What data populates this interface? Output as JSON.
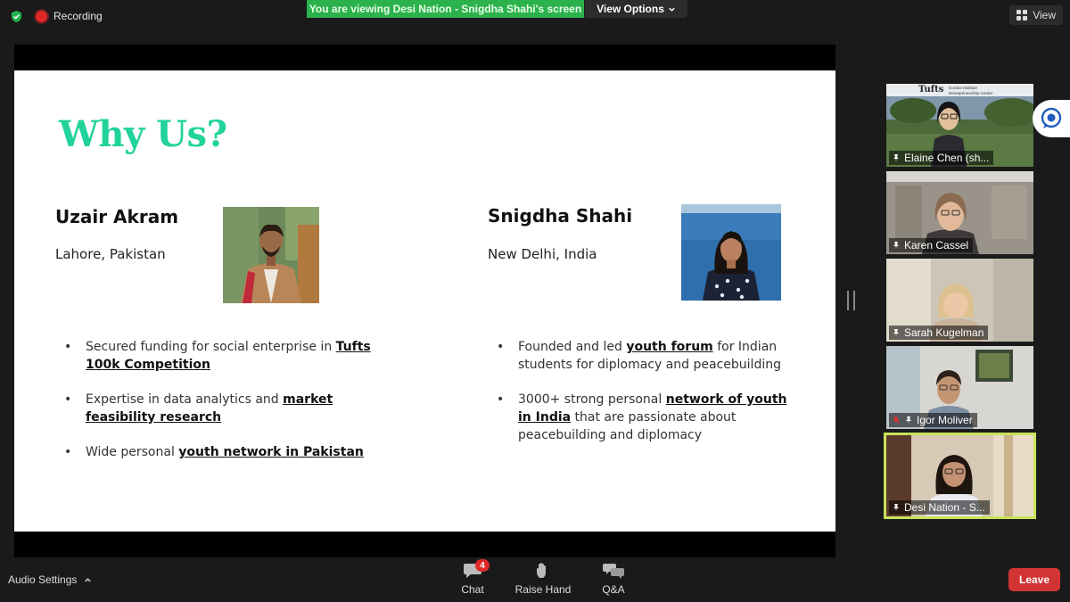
{
  "top_bar": {
    "recording_label": "Recording",
    "viewing_banner": "You are viewing Desi Nation - Snigdha Shahi's screen",
    "view_options_label": "View Options",
    "view_label": "View"
  },
  "slide": {
    "title": "Why Us?",
    "left": {
      "name": "Uzair Akram",
      "location": "Lahore, Pakistan",
      "bullets": [
        {
          "pre": "Secured funding for social enterprise in ",
          "link": "Tufts 100k Competition",
          "post": ""
        },
        {
          "pre": "Expertise in data analytics and ",
          "link": "market feasibility research",
          "post": ""
        },
        {
          "pre": "Wide personal ",
          "link": "youth network in Pakistan",
          "post": ""
        }
      ]
    },
    "right": {
      "name": "Snigdha Shahi",
      "location": "New Delhi, India",
      "bullets": [
        {
          "pre": "Founded and led ",
          "link": "youth forum",
          "post": " for Indian students for diplomacy and peacebuilding"
        },
        {
          "pre": "3000+ strong personal ",
          "link": "network of youth in India",
          "post": " that are passionate about peacebuilding and diplomacy"
        }
      ]
    }
  },
  "participants": [
    {
      "name": "Elaine Chen (sh...",
      "muted": false,
      "active": false,
      "bg_brand": "Tufts",
      "bg_subtitle_1": "Gordon Institute",
      "bg_subtitle_2": "Entrepreneurship Center"
    },
    {
      "name": "Karen Cassel",
      "muted": false,
      "active": false
    },
    {
      "name": "Sarah Kugelman",
      "muted": false,
      "active": false
    },
    {
      "name": "Igor Moliver",
      "muted": true,
      "active": false
    },
    {
      "name": "Desi Nation - S...",
      "muted": false,
      "active": true
    }
  ],
  "toolbar": {
    "audio_settings_label": "Audio Settings",
    "chat_label": "Chat",
    "chat_badge": "4",
    "raise_hand_label": "Raise Hand",
    "qa_label": "Q&A",
    "leave_label": "Leave"
  },
  "colors": {
    "banner_green": "#2bb24c",
    "title_green": "#21d39b",
    "leave_red": "#d23434",
    "active_border": "#c9e35a"
  }
}
